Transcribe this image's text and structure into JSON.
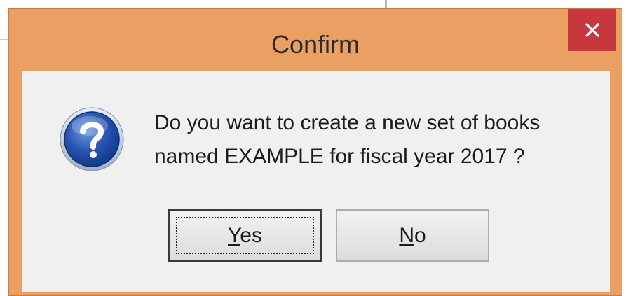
{
  "dialog": {
    "title": "Confirm",
    "close_glyph": "×",
    "message_line1": "Do you want to create a new set of books",
    "message_line2": "named EXAMPLE for fiscal year 2017 ?",
    "icon": "question-icon",
    "buttons": {
      "yes": {
        "accel": "Y",
        "rest": "es"
      },
      "no": {
        "accel": "N",
        "rest": "o"
      }
    }
  },
  "colors": {
    "titlebar": "#e9a062",
    "close_button": "#c7383e",
    "client": "#f0f0f0"
  }
}
